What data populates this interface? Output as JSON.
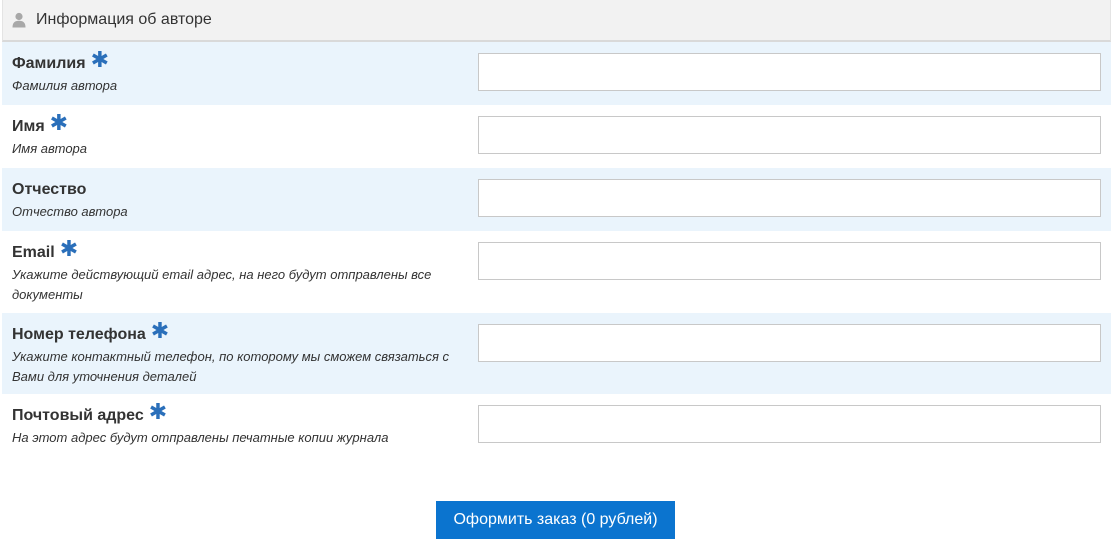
{
  "section": {
    "title": "Информация об авторе",
    "icon": "user-icon"
  },
  "fields": [
    {
      "label": "Фамилия",
      "required": true,
      "hint": "Фамилия автора",
      "value": ""
    },
    {
      "label": "Имя",
      "required": true,
      "hint": "Имя автора",
      "value": ""
    },
    {
      "label": "Отчество",
      "required": false,
      "hint": "Отчество автора",
      "value": ""
    },
    {
      "label": "Email",
      "required": true,
      "hint": "Укажите действующий email адрес, на него будут отправлены все документы",
      "value": ""
    },
    {
      "label": "Номер телефона",
      "required": true,
      "hint": "Укажите контактный телефон, по которому мы сможем связаться с Вами для уточнения деталей",
      "value": ""
    },
    {
      "label": "Почтовый адрес",
      "required": true,
      "hint": "На этот адрес будут отправлены печатные копии журнала",
      "value": ""
    }
  ],
  "required_marker": "✱",
  "submit": {
    "label": "Оформить заказ (0 рублей)"
  },
  "colors": {
    "accent": "#0b74cf",
    "required": "#2a6fba",
    "row_shade": "#eaf4fc",
    "header_bg": "#f2f2f2"
  }
}
